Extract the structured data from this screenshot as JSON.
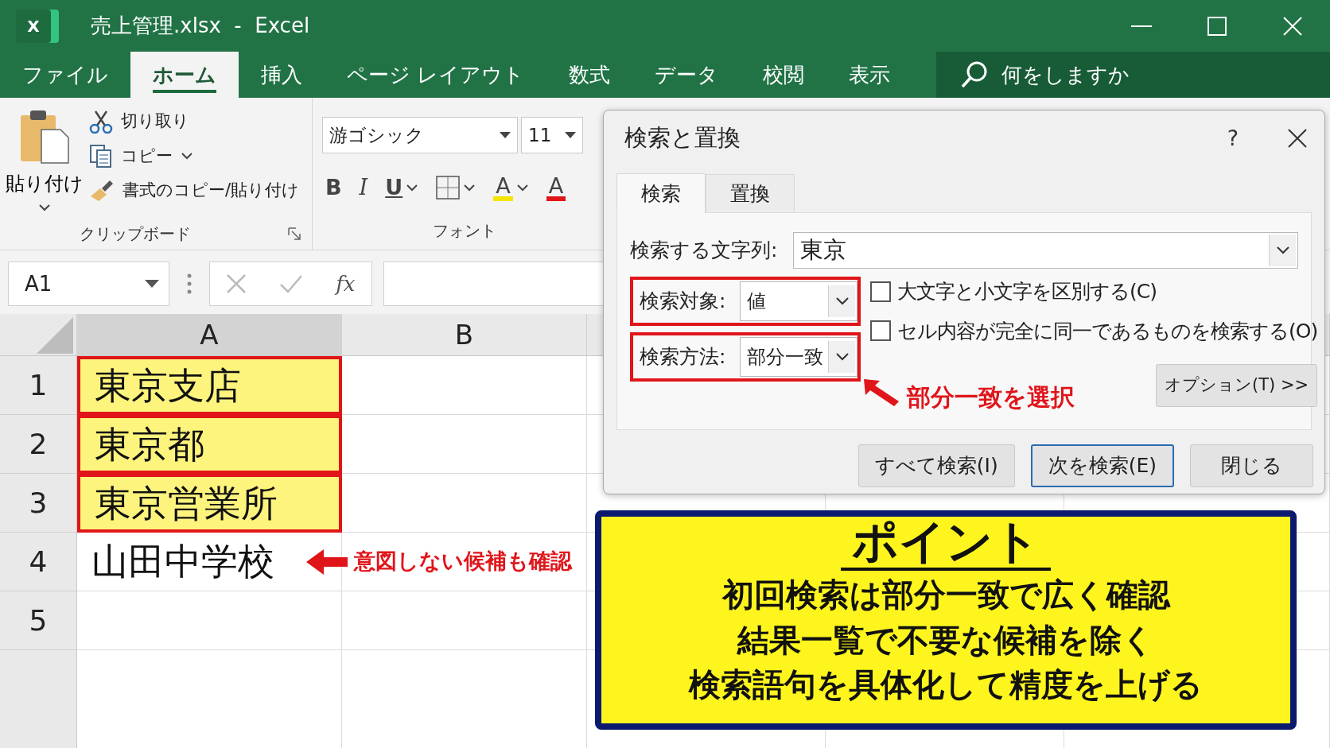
{
  "window": {
    "title": "売上管理.xlsx  -  Excel",
    "app_icon_letter": "X"
  },
  "ribbon_tabs": [
    {
      "label": "ファイル",
      "selected": false
    },
    {
      "label": "ホーム",
      "selected": true
    },
    {
      "label": "挿入",
      "selected": false
    },
    {
      "label": "ページ レイアウト",
      "selected": false
    },
    {
      "label": "数式",
      "selected": false
    },
    {
      "label": "データ",
      "selected": false
    },
    {
      "label": "校閲",
      "selected": false
    },
    {
      "label": "表示",
      "selected": false
    }
  ],
  "tell_me": {
    "placeholder": "何をしますか"
  },
  "clipboard": {
    "paste": "貼り付け",
    "cut": "切り取り",
    "copy": "コピー",
    "format_painter": "書式のコピー/貼り付け",
    "group_label": "クリップボード"
  },
  "font_group": {
    "font_name": "游ゴシック",
    "font_size": "11",
    "bold": "B",
    "italic": "I",
    "underline": "U",
    "fill_color": "A",
    "font_color": "A",
    "group_label": "フォント"
  },
  "formula_bar": {
    "name_box": "A1",
    "function_label": "fx"
  },
  "sheet": {
    "columns": [
      {
        "label": "A",
        "selected": true
      },
      {
        "label": "B",
        "selected": false
      }
    ],
    "rows": [
      {
        "number": "1",
        "value": "東京支店",
        "highlighted": true
      },
      {
        "number": "2",
        "value": "東京都",
        "highlighted": true
      },
      {
        "number": "3",
        "value": "東京営業所",
        "highlighted": true
      },
      {
        "number": "4",
        "value": "山田中学校",
        "highlighted": false
      },
      {
        "number": "5",
        "highlighted": false
      }
    ],
    "annotation": "意図しない候補も確認"
  },
  "dialog": {
    "title": "検索と置換",
    "help": "?",
    "tabs": [
      {
        "label": "検索",
        "selected": true
      },
      {
        "label": "置換",
        "selected": false
      }
    ],
    "find_what": {
      "label": "検索する文字列:",
      "value": "東京"
    },
    "options": [
      {
        "label": "検索対象:",
        "value": "値",
        "highlighted": true
      },
      {
        "label": "検索方法:",
        "value": "部分一致",
        "highlighted": true
      }
    ],
    "checkboxes": [
      {
        "label": "大文字と小文字を区別する(C)",
        "checked": false
      },
      {
        "label": "セル内容が完全に同一であるものを検索する(O)",
        "checked": false
      }
    ],
    "options_button": "オプション(T) >>",
    "callout": "部分一致を選択",
    "buttons": [
      {
        "label": "すべて検索(I)",
        "default": false
      },
      {
        "label": "次を検索(E)",
        "default": true
      },
      {
        "label": "閉じる",
        "default": false
      }
    ]
  },
  "point": {
    "title": "ポイント",
    "lines": [
      "初回検索は部分一致で広く確認",
      "結果一覧で不要な候補を除く",
      "検索語句を具体化して精度を上げる"
    ]
  }
}
